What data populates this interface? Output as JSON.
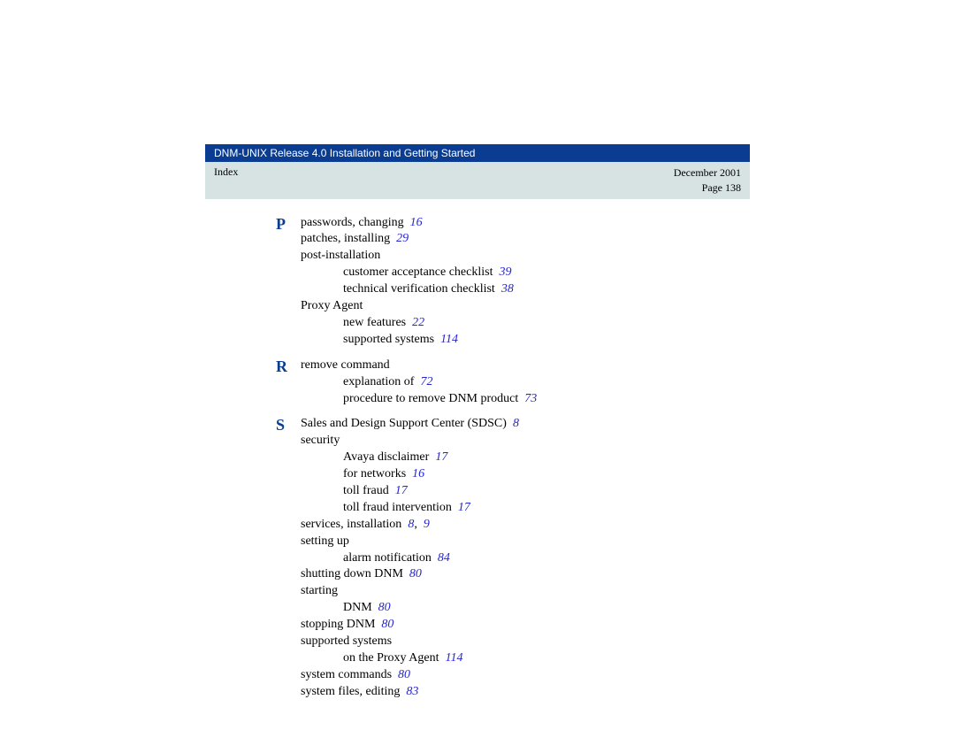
{
  "header": {
    "title": "DNM-UNIX Release 4.0 Installation and Getting Started",
    "section": "Index",
    "date": "December 2001",
    "page": "Page 138"
  },
  "sections": [
    {
      "letter": "P",
      "lines": [
        {
          "text": "passwords, changing",
          "refs": [
            "16"
          ],
          "indent": 0
        },
        {
          "text": "patches, installing",
          "refs": [
            "29"
          ],
          "indent": 0
        },
        {
          "text": "post-installation",
          "refs": [],
          "indent": 0
        },
        {
          "text": "customer acceptance checklist",
          "refs": [
            "39"
          ],
          "indent": 1
        },
        {
          "text": "technical verification checklist",
          "refs": [
            "38"
          ],
          "indent": 1
        },
        {
          "text": "Proxy Agent",
          "refs": [],
          "indent": 0
        },
        {
          "text": "new features",
          "refs": [
            "22"
          ],
          "indent": 1
        },
        {
          "text": "supported systems",
          "refs": [
            "114"
          ],
          "indent": 1
        }
      ]
    },
    {
      "letter": "R",
      "lines": [
        {
          "text": "remove command",
          "refs": [],
          "indent": 0
        },
        {
          "text": "explanation of",
          "refs": [
            "72"
          ],
          "indent": 1
        },
        {
          "text": "procedure to remove DNM product",
          "refs": [
            "73"
          ],
          "indent": 1
        }
      ]
    },
    {
      "letter": "S",
      "lines": [
        {
          "text": "Sales and Design Support Center (SDSC)",
          "refs": [
            "8"
          ],
          "indent": 0
        },
        {
          "text": "security",
          "refs": [],
          "indent": 0
        },
        {
          "text": "Avaya disclaimer",
          "refs": [
            "17"
          ],
          "indent": 1
        },
        {
          "text": "for networks",
          "refs": [
            "16"
          ],
          "indent": 1
        },
        {
          "text": "toll fraud",
          "refs": [
            "17"
          ],
          "indent": 1
        },
        {
          "text": "toll fraud intervention",
          "refs": [
            "17"
          ],
          "indent": 1
        },
        {
          "text": "services, installation",
          "refs": [
            "8",
            "9"
          ],
          "indent": 0
        },
        {
          "text": "setting up",
          "refs": [],
          "indent": 0
        },
        {
          "text": "alarm notification",
          "refs": [
            "84"
          ],
          "indent": 1
        },
        {
          "text": "shutting down DNM",
          "refs": [
            "80"
          ],
          "indent": 0
        },
        {
          "text": "starting",
          "refs": [],
          "indent": 0
        },
        {
          "text": "DNM",
          "refs": [
            "80"
          ],
          "indent": 1
        },
        {
          "text": "stopping DNM",
          "refs": [
            "80"
          ],
          "indent": 0
        },
        {
          "text": "supported systems",
          "refs": [],
          "indent": 0
        },
        {
          "text": "on the Proxy Agent",
          "refs": [
            "114"
          ],
          "indent": 1
        },
        {
          "text": "system commands",
          "refs": [
            "80"
          ],
          "indent": 0
        },
        {
          "text": "system files, editing",
          "refs": [
            "83"
          ],
          "indent": 0
        }
      ]
    }
  ]
}
